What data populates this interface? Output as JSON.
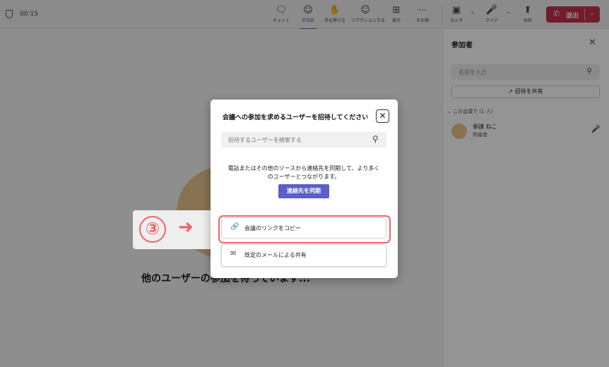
{
  "topbar": {
    "timer": "00:15",
    "tools": [
      {
        "icon": "chat-icon",
        "label": "チャット"
      },
      {
        "icon": "people-icon",
        "label": "参加者"
      },
      {
        "icon": "raise-hand-icon",
        "label": "手を挙げる"
      },
      {
        "icon": "reaction-icon",
        "label": "リアクションする"
      },
      {
        "icon": "view-icon",
        "label": "表示"
      },
      {
        "icon": "more-icon",
        "label": "その他"
      },
      {
        "icon": "camera-off-icon",
        "label": "カメラ"
      },
      {
        "icon": "mic-icon",
        "label": "マイク"
      },
      {
        "icon": "share-icon",
        "label": "共有"
      }
    ],
    "leave_label": "退出"
  },
  "stage": {
    "waiting_text": "他のユーザーの参加を待っています..."
  },
  "panel": {
    "title": "参加者",
    "search_placeholder": "名前を入力",
    "share_invite_label": "招待を共有",
    "section_label": "この会議で (1 人)",
    "participant": {
      "name": "参謀 ねこ",
      "role": "開催者"
    }
  },
  "dialog": {
    "title": "会議への参加を求めるユーザーを招待してください",
    "search_placeholder": "招待するユーザーを検索する",
    "info_line1": "電話またはその他のソースから連絡先を同期して、より多く",
    "info_line2": "のユーザーとつながります。",
    "sync_button": "連絡先を同期",
    "copy_link_label": "会議のリンクをコピー",
    "share_mail_label": "既定のメールによる共有"
  },
  "callout": {
    "step": "③"
  },
  "colors": {
    "accent": "#5b5fc7",
    "leave": "#c4314b",
    "highlight": "#f0636b"
  }
}
